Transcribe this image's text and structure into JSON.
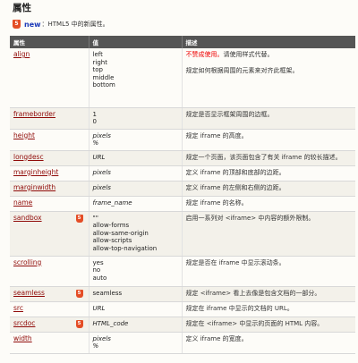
{
  "page": {
    "heading": "属性",
    "new_badge": "5",
    "new_word": "new",
    "new_text": "：HTML5 中的新属性。"
  },
  "table": {
    "headers": {
      "attribute": "属性",
      "value": "值",
      "description": "描述"
    },
    "rows": [
      {
        "name": "align",
        "html5": false,
        "values": [
          "left",
          "right",
          "top",
          "middle",
          "bottom"
        ],
        "italic": false,
        "desc_red": "不赞成使用。",
        "desc": "请使用样式代替。",
        "desc2": "规定如何根据周围的元素来对齐此框架。"
      },
      {
        "name": "frameborder",
        "html5": false,
        "values": [
          "1",
          "0"
        ],
        "italic": false,
        "desc": "规定是否显示框架周围的边框。"
      },
      {
        "name": "height",
        "html5": false,
        "values": [
          "pixels",
          "%"
        ],
        "italic": true,
        "desc": "规定 iframe 的高度。"
      },
      {
        "name": "longdesc",
        "html5": false,
        "values": [
          "URL"
        ],
        "italic": true,
        "desc": "规定一个页面，该页面包含了有关 iframe 的较长描述。"
      },
      {
        "name": "marginheight",
        "html5": false,
        "values": [
          "pixels"
        ],
        "italic": true,
        "desc": "定义 iframe 的顶部和底部的边距。"
      },
      {
        "name": "marginwidth",
        "html5": false,
        "values": [
          "pixels"
        ],
        "italic": true,
        "desc": "定义 iframe 的左侧和右侧的边距。"
      },
      {
        "name": "name",
        "html5": false,
        "values": [
          "frame_name"
        ],
        "italic": true,
        "desc": "规定 iframe 的名称。"
      },
      {
        "name": "sandbox",
        "html5": true,
        "values": [
          "\"\"",
          "allow-forms",
          "allow-same-origin",
          "allow-scripts",
          "allow-top-navigation"
        ],
        "italic": false,
        "desc": "启用一系列对 <iframe> 中内容的额外限制。"
      },
      {
        "name": "scrolling",
        "html5": false,
        "values": [
          "yes",
          "no",
          "auto"
        ],
        "italic": false,
        "desc": "规定是否在 iframe 中显示滚动条。"
      },
      {
        "name": "seamless",
        "html5": true,
        "values": [
          "seamless"
        ],
        "italic": false,
        "desc": "规定 <iframe> 看上去像是包含文档的一部分。"
      },
      {
        "name": "src",
        "html5": false,
        "values": [
          "URL"
        ],
        "italic": true,
        "desc": "规定在 iframe 中显示的文档的 URL。"
      },
      {
        "name": "srcdoc",
        "html5": true,
        "values": [
          "HTML_code"
        ],
        "italic": true,
        "desc": "规定在 <iframe> 中显示的页面的 HTML 内容。"
      },
      {
        "name": "width",
        "html5": false,
        "values": [
          "pixels",
          "%"
        ],
        "italic": true,
        "desc": "定义 iframe 的宽度。"
      }
    ]
  }
}
